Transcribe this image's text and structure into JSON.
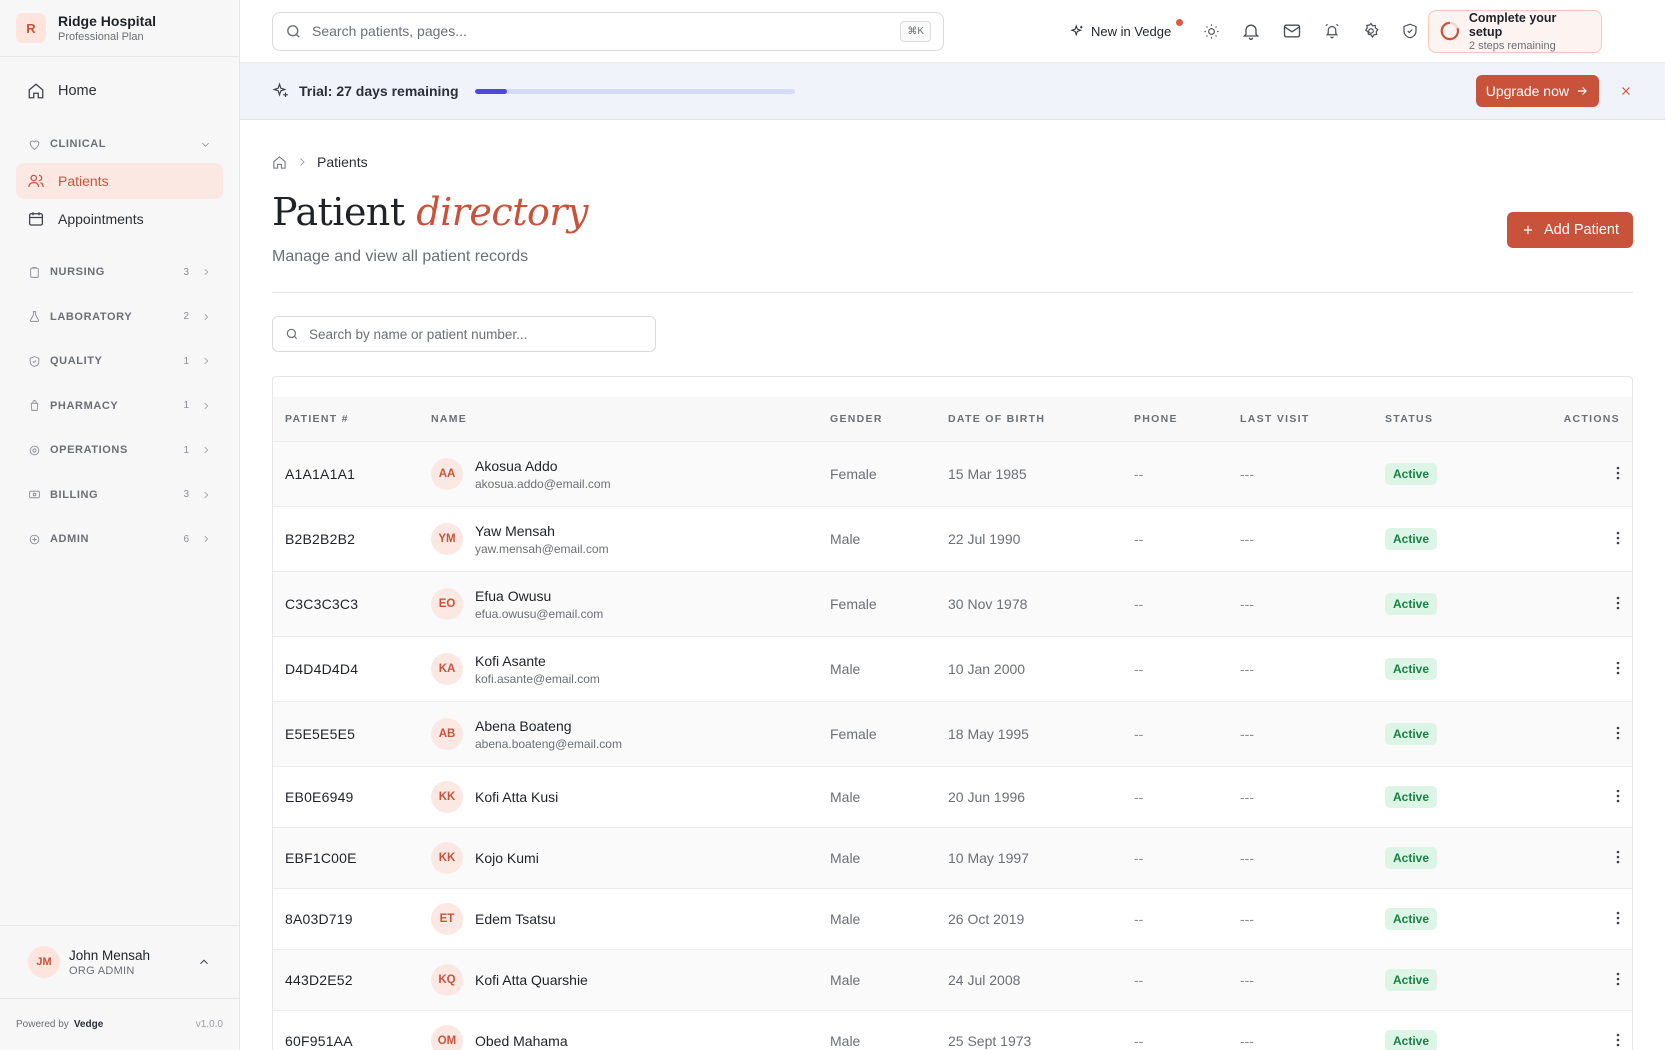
{
  "org": {
    "initial": "R",
    "name": "Ridge Hospital",
    "plan": "Professional Plan"
  },
  "nav": {
    "home": "Home",
    "clinical": {
      "label": "CLINICAL",
      "items": [
        "Patients",
        "Appointments"
      ]
    },
    "sections": [
      {
        "label": "NURSING",
        "count": "3"
      },
      {
        "label": "LABORATORY",
        "count": "2"
      },
      {
        "label": "QUALITY",
        "count": "1"
      },
      {
        "label": "PHARMACY",
        "count": "1"
      },
      {
        "label": "OPERATIONS",
        "count": "1"
      },
      {
        "label": "BILLING",
        "count": "3"
      },
      {
        "label": "ADMIN",
        "count": "6"
      }
    ]
  },
  "user": {
    "initials": "JM",
    "name": "John Mensah",
    "role": "ORG ADMIN"
  },
  "footer": {
    "powered": "Powered by",
    "brand": "Vedge",
    "version": "v1.0.0"
  },
  "topbar": {
    "search_placeholder": "Search patients, pages...",
    "shortcut": "⌘K",
    "new_in": "New in Vedge",
    "setup_title": "Complete your setup",
    "setup_sub": "2 steps remaining"
  },
  "trial": {
    "text": "Trial: 27 days remaining",
    "progress": 0.1,
    "upgrade": "Upgrade now"
  },
  "breadcrumb": {
    "current": "Patients"
  },
  "page": {
    "title_a": "Patient",
    "title_b": "directory",
    "subtitle": "Manage and view all patient records",
    "add_button": "Add Patient",
    "search_placeholder": "Search by name or patient number..."
  },
  "table": {
    "headers": [
      "PATIENT #",
      "NAME",
      "GENDER",
      "DATE OF BIRTH",
      "PHONE",
      "LAST VISIT",
      "STATUS",
      "ACTIONS"
    ],
    "rows": [
      {
        "id": "A1A1A1A1",
        "initials": "AA",
        "name": "Akosua Addo",
        "email": "akosua.addo@email.com",
        "gender": "Female",
        "dob": "15 Mar 1985",
        "phone": "--",
        "last_visit": "---",
        "status": "Active"
      },
      {
        "id": "B2B2B2B2",
        "initials": "YM",
        "name": "Yaw Mensah",
        "email": "yaw.mensah@email.com",
        "gender": "Male",
        "dob": "22 Jul 1990",
        "phone": "--",
        "last_visit": "---",
        "status": "Active"
      },
      {
        "id": "C3C3C3C3",
        "initials": "EO",
        "name": "Efua Owusu",
        "email": "efua.owusu@email.com",
        "gender": "Female",
        "dob": "30 Nov 1978",
        "phone": "--",
        "last_visit": "---",
        "status": "Active"
      },
      {
        "id": "D4D4D4D4",
        "initials": "KA",
        "name": "Kofi Asante",
        "email": "kofi.asante@email.com",
        "gender": "Male",
        "dob": "10 Jan 2000",
        "phone": "--",
        "last_visit": "---",
        "status": "Active"
      },
      {
        "id": "E5E5E5E5",
        "initials": "AB",
        "name": "Abena Boateng",
        "email": "abena.boateng@email.com",
        "gender": "Female",
        "dob": "18 May 1995",
        "phone": "--",
        "last_visit": "---",
        "status": "Active"
      },
      {
        "id": "EB0E6949",
        "initials": "KK",
        "name": "Kofi Atta Kusi",
        "email": "",
        "gender": "Male",
        "dob": "20 Jun 1996",
        "phone": "--",
        "last_visit": "---",
        "status": "Active"
      },
      {
        "id": "EBF1C00E",
        "initials": "KK",
        "name": "Kojo Kumi",
        "email": "",
        "gender": "Male",
        "dob": "10 May 1997",
        "phone": "--",
        "last_visit": "---",
        "status": "Active"
      },
      {
        "id": "8A03D719",
        "initials": "ET",
        "name": "Edem Tsatsu",
        "email": "",
        "gender": "Male",
        "dob": "26 Oct 2019",
        "phone": "--",
        "last_visit": "---",
        "status": "Active"
      },
      {
        "id": "443D2E52",
        "initials": "KQ",
        "name": "Kofi Atta Quarshie",
        "email": "",
        "gender": "Male",
        "dob": "24 Jul 2008",
        "phone": "--",
        "last_visit": "---",
        "status": "Active"
      },
      {
        "id": "60F951AA",
        "initials": "OM",
        "name": "Obed Mahama",
        "email": "",
        "gender": "Male",
        "dob": "25 Sept 1973",
        "phone": "--",
        "last_visit": "---",
        "status": "Active"
      }
    ]
  },
  "colors": {
    "accent": "#c8533a",
    "accent_soft": "#fce8e2",
    "progress": "#4f46e5",
    "status_bg": "#dcf5e6",
    "status_fg": "#1a7f45"
  }
}
